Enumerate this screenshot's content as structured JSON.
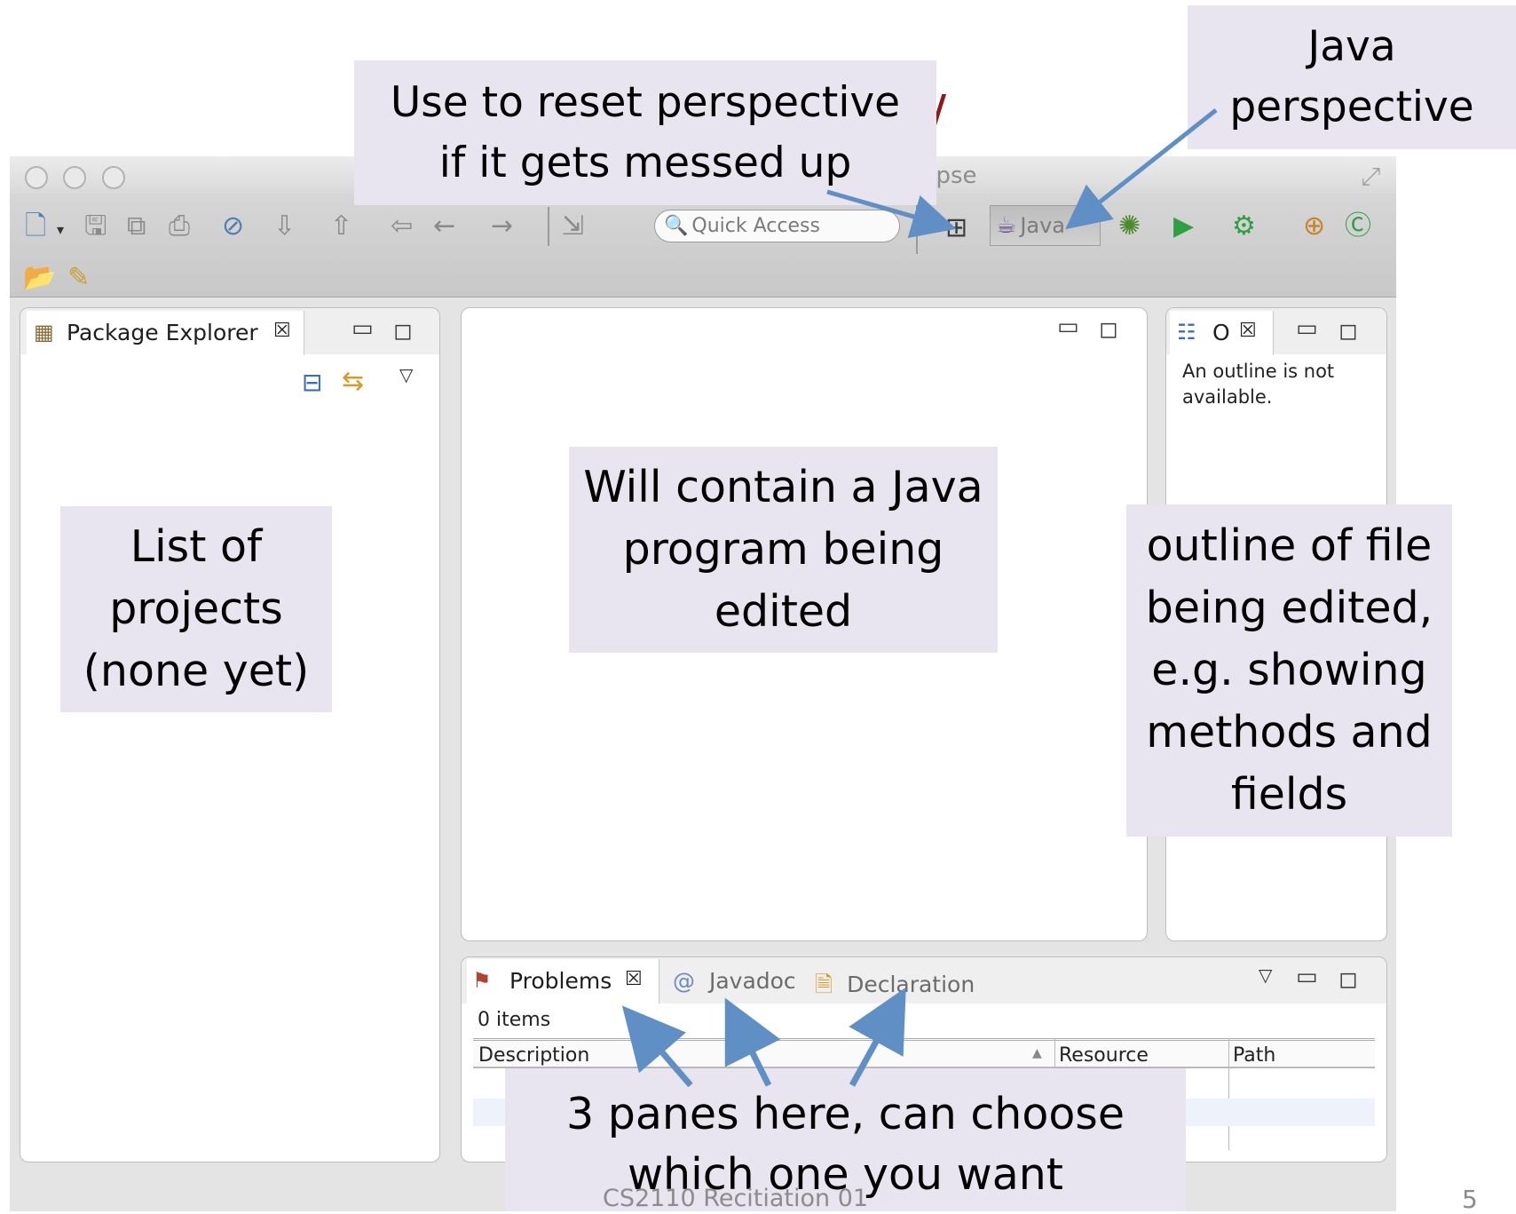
{
  "window": {
    "title_fragment": "lipse"
  },
  "toolbar": {
    "quick_access_placeholder": "Quick Access",
    "perspective_label": "Java"
  },
  "package_explorer": {
    "tab_label": "Package Explorer"
  },
  "outline": {
    "tab_label": "O",
    "message": "An outline is not available."
  },
  "bottom": {
    "tabs": [
      "Problems",
      "Javadoc",
      "Declaration"
    ],
    "status": "0 items",
    "columns": [
      "Description",
      "Resource",
      "Path"
    ]
  },
  "callouts": {
    "reset": "Use to reset perspective\nif it gets messed up",
    "java": "Java\nperspective",
    "list": "List of\nprojects\n(none yet)",
    "editor": "Will contain a Java\nprogram being\nedited",
    "outline": "outline of file\nbeing edited,\ne.g. showing\nmethods and\nfields",
    "panes": "3 panes here, can choose\nwhich one you want"
  },
  "footer": {
    "text": "CS2110 Recitiation 01",
    "slide_number": "5"
  },
  "colors": {
    "callout_bg": "#e8e4f0",
    "arrow": "#5f8fc4"
  }
}
